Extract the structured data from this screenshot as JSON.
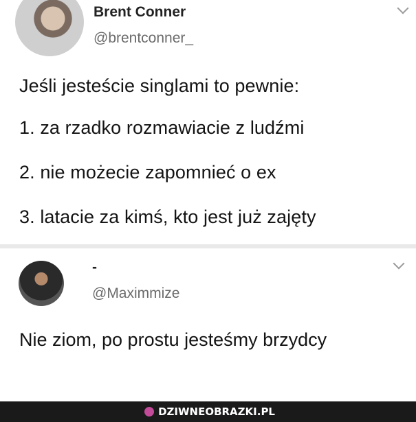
{
  "tweets": [
    {
      "name": "Brent Conner",
      "handle": "@brentconner_",
      "lines": [
        "Jeśli jesteście singlami to pewnie:",
        "1. za rzadko rozmawiacie z ludźmi",
        "2. nie możecie zapomnieć o ex",
        "3. latacie za kimś, kto jest już zajęty"
      ]
    },
    {
      "name": "-",
      "handle": "@Maximmize",
      "text": "Nie ziom, po prostu jesteśmy brzydcy"
    }
  ],
  "watermark": "DZIWNEOBRAZKI.PL"
}
